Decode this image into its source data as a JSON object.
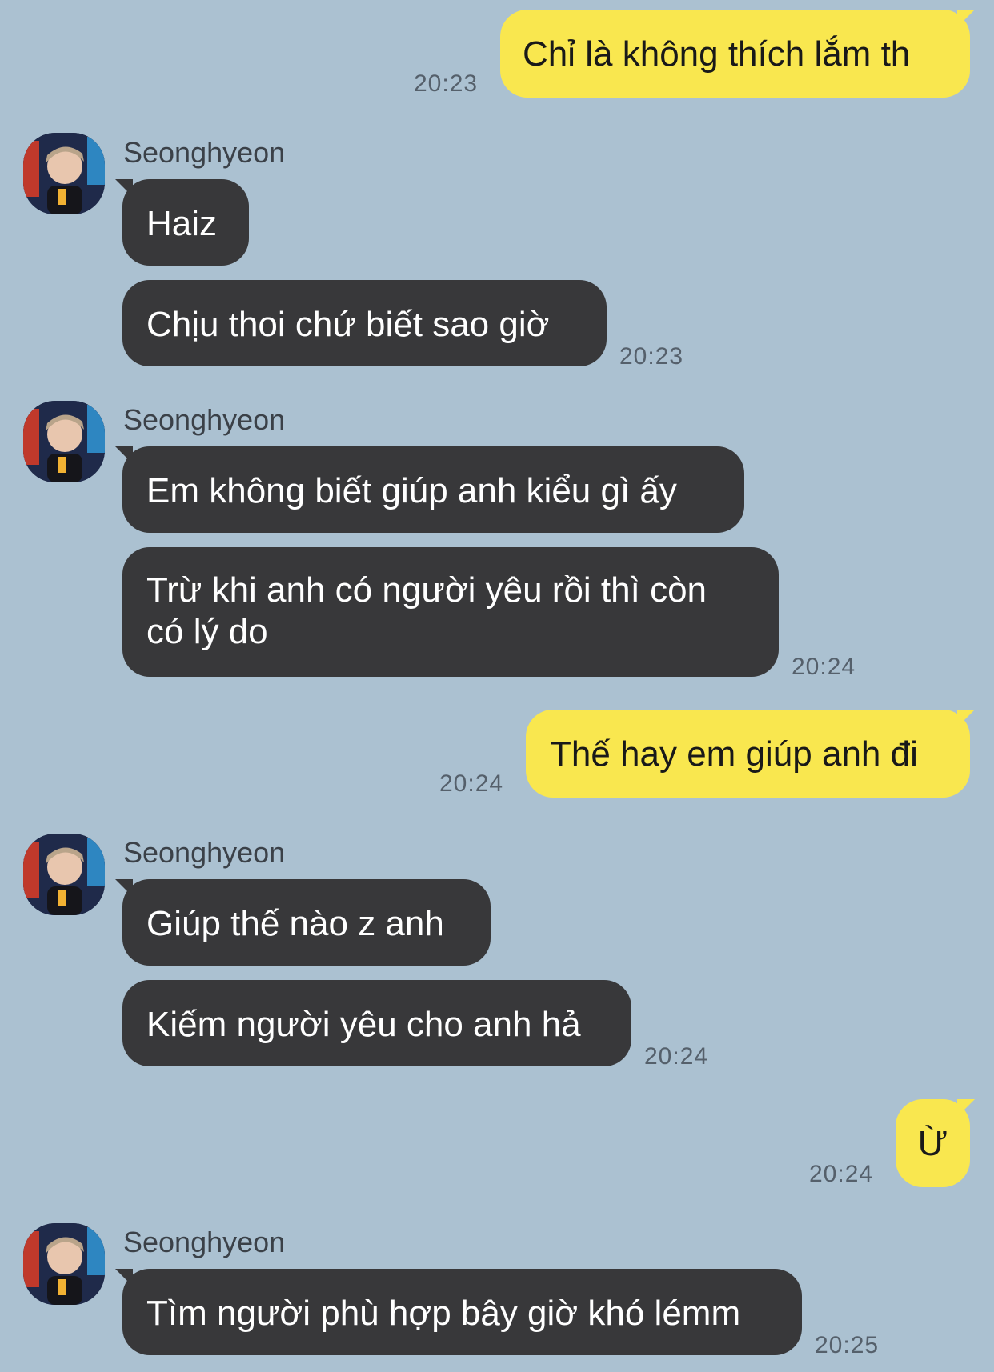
{
  "contact": {
    "name": "Seonghyeon"
  },
  "messages": [
    {
      "dir": "out",
      "text": "Chỉ là không thích lắm th",
      "time": "20:23"
    },
    {
      "dir": "in",
      "text": "Haiz"
    },
    {
      "dir": "in",
      "text": "Chịu thoi chứ biết sao giờ",
      "time": "20:23"
    },
    {
      "dir": "in",
      "text": "Em không biết giúp anh kiểu gì ấy"
    },
    {
      "dir": "in",
      "line1": "Trừ khi anh có người yêu rồi thì còn",
      "line2": "có lý do",
      "time": "20:24"
    },
    {
      "dir": "out",
      "text": "Thế hay em giúp anh đi",
      "time": "20:24"
    },
    {
      "dir": "in",
      "text": "Giúp thế nào z anh"
    },
    {
      "dir": "in",
      "text": "Kiếm người yêu cho anh hả",
      "time": "20:24"
    },
    {
      "dir": "out",
      "text": "Ừ",
      "time": "20:24"
    },
    {
      "dir": "in",
      "text": "Tìm người phù hợp bây giờ khó lémm",
      "time": "20:25"
    }
  ],
  "colors": {
    "background": "#abc1d1",
    "outgoing_bubble": "#f9e74f",
    "incoming_bubble": "#38383a",
    "time_text": "#55606b"
  }
}
